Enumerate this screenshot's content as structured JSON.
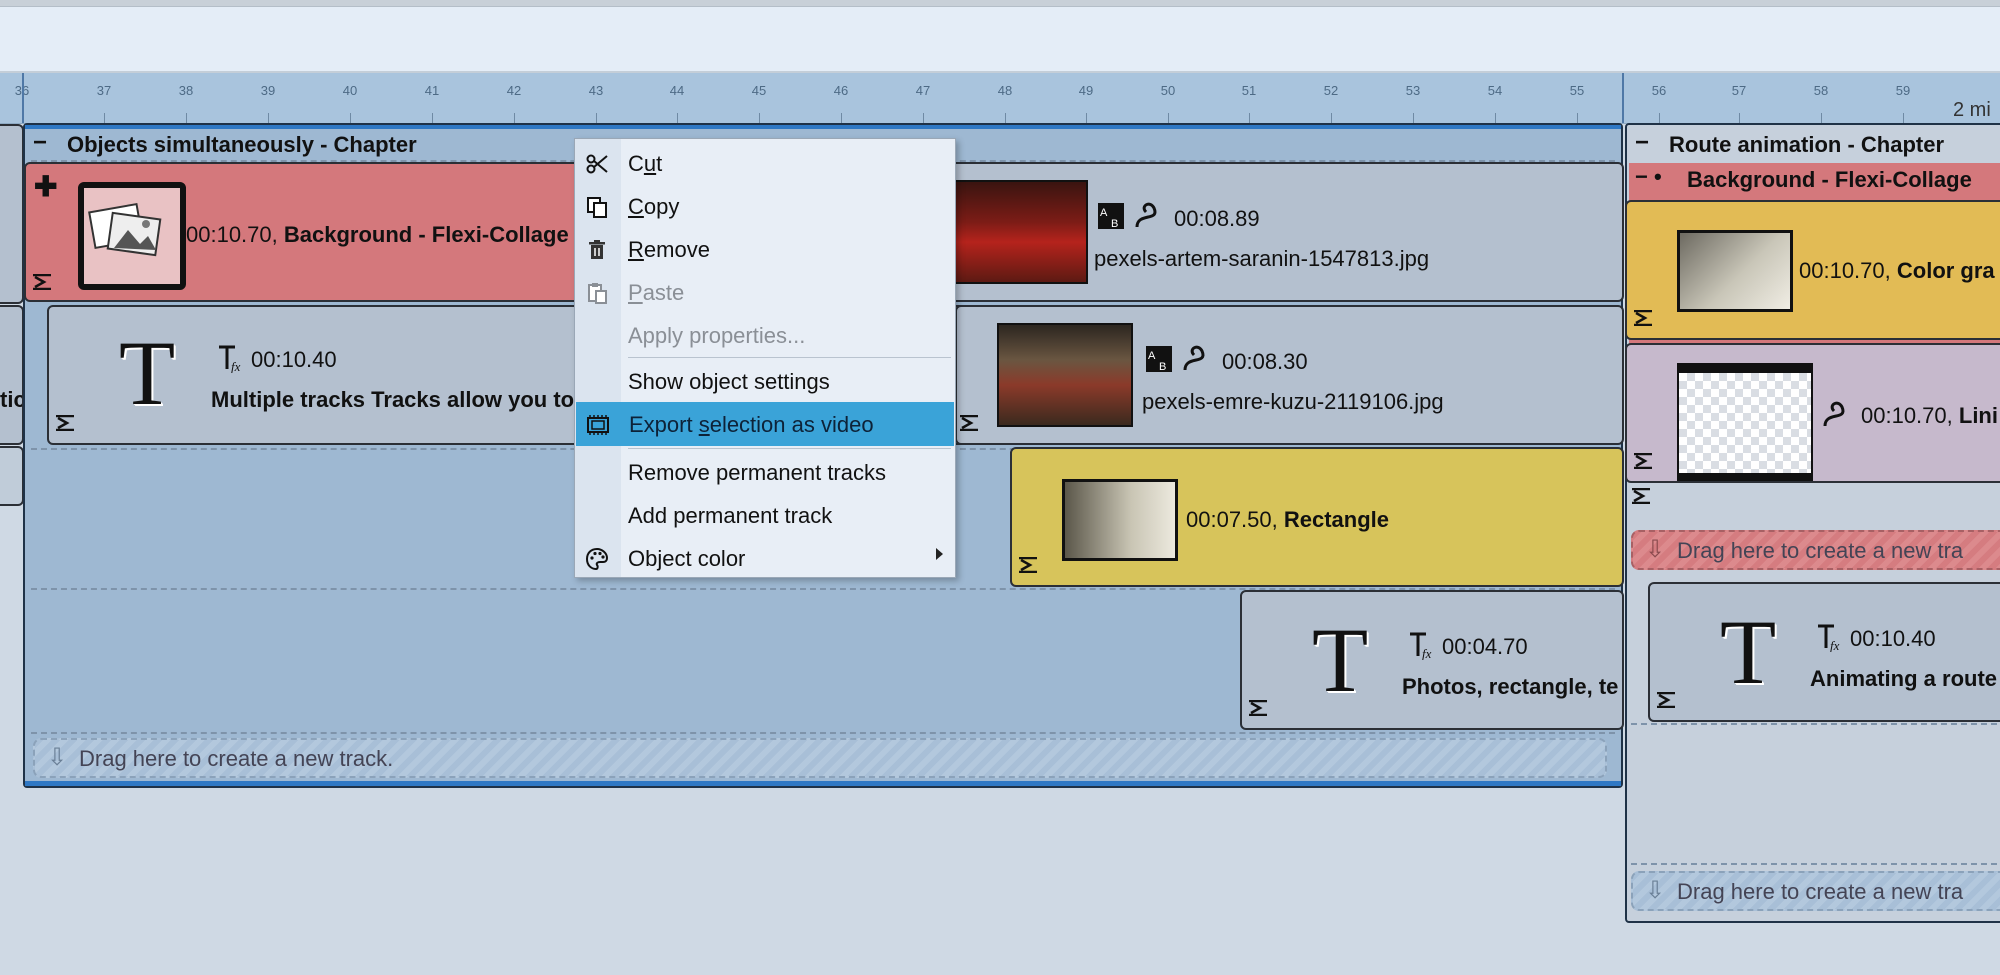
{
  "ruler": {
    "ticks": [
      "36",
      "37",
      "38",
      "39",
      "40",
      "41",
      "42",
      "43",
      "44",
      "45",
      "46",
      "47",
      "48",
      "49",
      "50",
      "51",
      "52",
      "53",
      "54",
      "55",
      "56",
      "57",
      "58",
      "59"
    ],
    "end_label": "2 mi"
  },
  "chapter_main": {
    "title": "Objects simultaneously - Chapter",
    "collapse": "−",
    "drag_hint": "Drag here to create a new track."
  },
  "clips": {
    "background": {
      "time": "00:10.70,",
      "name": "Background - Flexi-Collage"
    },
    "text1": {
      "time": "00:10.40",
      "name": "Multiple tracks Tracks allow you to"
    },
    "photo1": {
      "time": "00:08.89",
      "name": "pexels-artem-saranin-1547813.jpg"
    },
    "photo2": {
      "time": "00:08.30",
      "name": "pexels-emre-kuzu-2119106.jpg"
    },
    "rectangle": {
      "time": "00:07.50,",
      "name": "Rectangle"
    },
    "text2": {
      "time": "00:04.70",
      "name": "Photos, rectangle, te"
    },
    "left_fragment": "tic"
  },
  "chapter_route": {
    "title": "Route animation - Chapter",
    "collapse": "−",
    "sub_title": "Background - Flexi-Collage",
    "sub_controls": "− •",
    "color_gradient": {
      "time": "00:10.70,",
      "name": "Color gra"
    },
    "line": {
      "time": "00:10.70,",
      "name": "Lini"
    },
    "drag_hint_1": "Drag here to create a new tra",
    "text": {
      "time": "00:10.40",
      "name": "Animating a route"
    },
    "drag_hint_2": "Drag here to create a new tra"
  },
  "context_menu": {
    "items": [
      {
        "label_pre": "C",
        "label_u": "u",
        "label_post": "t",
        "icon": "scissors-icon"
      },
      {
        "label_pre": "",
        "label_u": "C",
        "label_post": "opy",
        "icon": "copy-icon"
      },
      {
        "label_pre": "",
        "label_u": "R",
        "label_post": "emove",
        "icon": "trash-icon"
      },
      {
        "label_pre": "",
        "label_u": "P",
        "label_post": "aste",
        "icon": "paste-icon"
      },
      {
        "label": "Apply properties..."
      },
      {
        "label": "Show object settings"
      },
      {
        "label_pre": "Export ",
        "label_u": "s",
        "label_post": "election as video",
        "icon": "film-icon"
      },
      {
        "label": "Remove permanent tracks"
      },
      {
        "label": "Add permanent track"
      },
      {
        "label": "Object color",
        "icon": "palette-icon"
      }
    ]
  },
  "colors": {
    "highlight": "#3aa3d8",
    "chapter_bar": "#2f78c4",
    "clip_red": "#d4787c",
    "clip_yellow": "#d7c45b"
  }
}
